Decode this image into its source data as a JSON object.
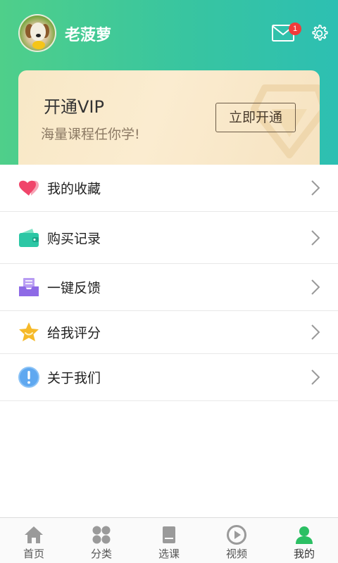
{
  "profile": {
    "username": "老菠萝",
    "unread_count": "1"
  },
  "vip": {
    "title": "开通VIP",
    "subtitle": "海量课程任你学!",
    "button_label": "立即开通"
  },
  "menu": [
    {
      "label": "我的收藏",
      "icon": "heart-icon"
    },
    {
      "label": "购买记录",
      "icon": "wallet-icon"
    },
    {
      "label": "一键反馈",
      "icon": "inbox-icon"
    },
    {
      "label": "给我评分",
      "icon": "star-icon"
    },
    {
      "label": "关于我们",
      "icon": "info-icon"
    }
  ],
  "tabs": [
    {
      "label": "首页",
      "icon": "home-icon"
    },
    {
      "label": "分类",
      "icon": "grid-icon"
    },
    {
      "label": "选课",
      "icon": "book-icon"
    },
    {
      "label": "视频",
      "icon": "play-icon"
    },
    {
      "label": "我的",
      "icon": "user-icon"
    }
  ],
  "active_tab": "我的",
  "colors": {
    "header_start": "#4fcf8a",
    "header_end": "#2dbfb2",
    "accent_green": "#2bbf63",
    "badge_red": "#f03b3b"
  }
}
